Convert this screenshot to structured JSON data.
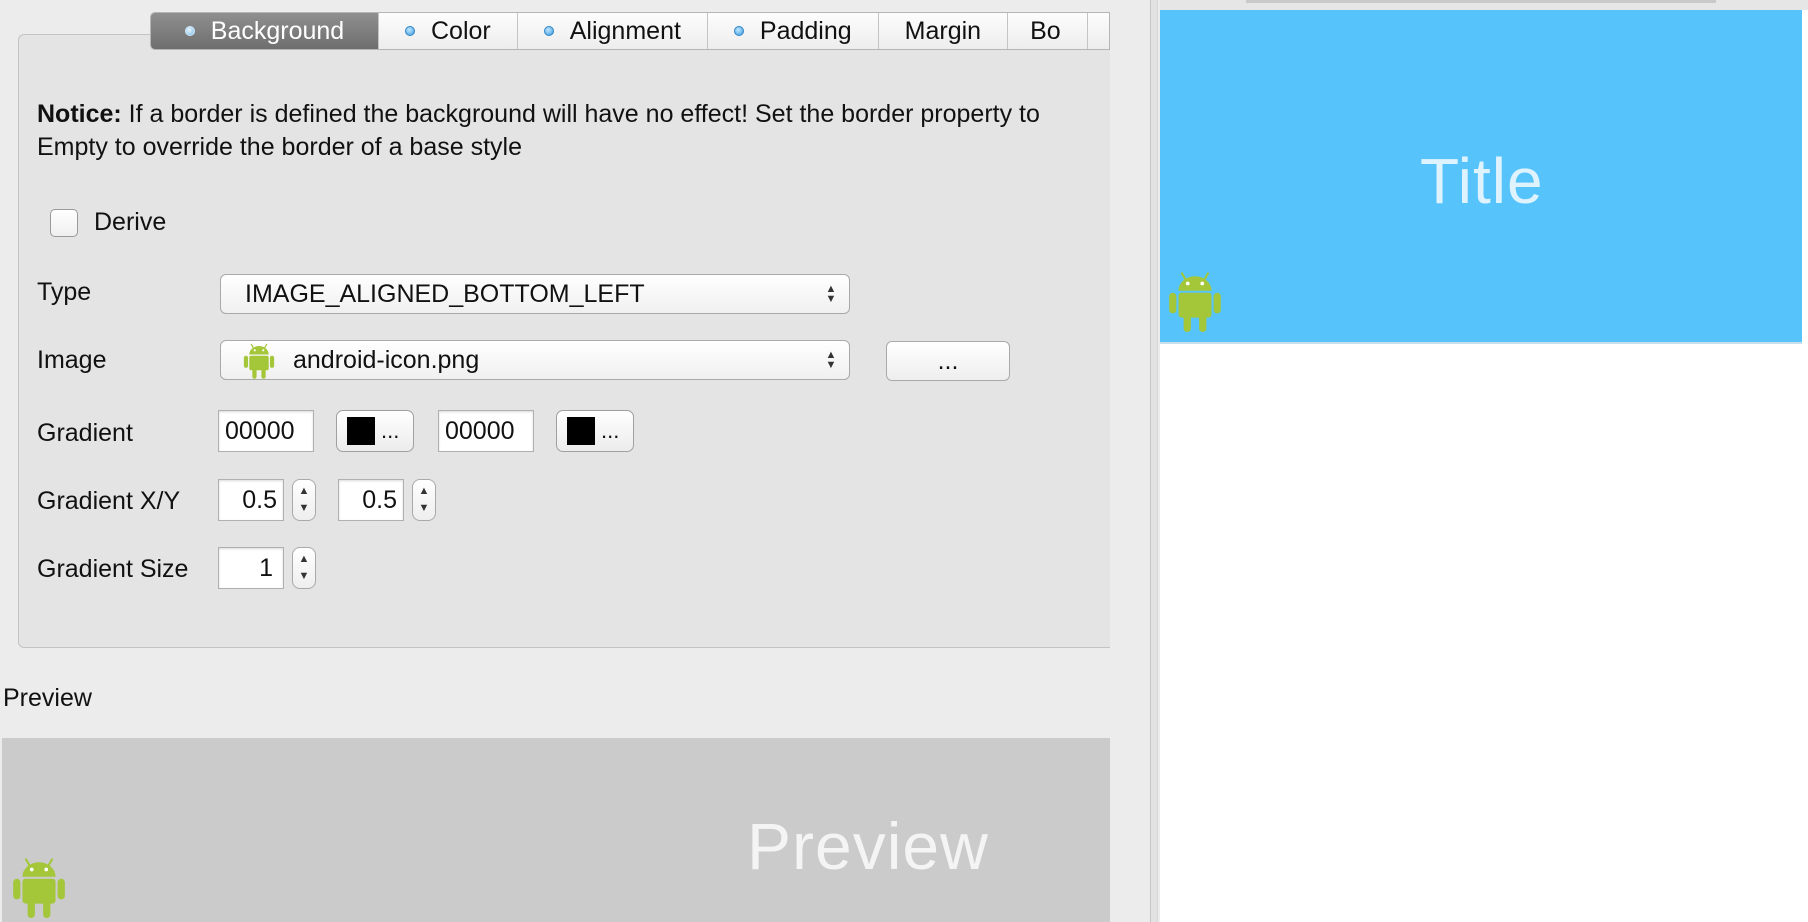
{
  "tabs": [
    {
      "label": "Background",
      "active": true,
      "dot": true
    },
    {
      "label": "Color",
      "active": false,
      "dot": true
    },
    {
      "label": "Alignment",
      "active": false,
      "dot": true
    },
    {
      "label": "Padding",
      "active": false,
      "dot": true
    },
    {
      "label": "Margin",
      "active": false,
      "dot": false
    },
    {
      "label": "Bo",
      "active": false,
      "dot": false
    }
  ],
  "notice": {
    "bold": "Notice:",
    "text": " If a border is defined the background will have no effect! Set the border property to Empty to override the border of a base style"
  },
  "derive": {
    "label": "Derive",
    "checked": false
  },
  "form": {
    "type_label": "Type",
    "type_value": "IMAGE_ALIGNED_BOTTOM_LEFT",
    "image_label": "Image",
    "image_value": "android-icon.png",
    "image_browse_label": "...",
    "gradient_label": "Gradient",
    "gradient_start": "00000",
    "gradient_end": "00000",
    "color_button_label": "...",
    "gradient_xy_label": "Gradient X/Y",
    "gradient_x": "0.5",
    "gradient_y": "0.5",
    "gradient_size_label": "Gradient Size",
    "gradient_size": "1"
  },
  "preview": {
    "heading": "Preview",
    "text": "Preview"
  },
  "canvas": {
    "title": "Title"
  },
  "colors": {
    "banner": "#56c4fb",
    "android_green": "#a4c639",
    "swatch": "#000000"
  },
  "icons": {
    "android": "android-icon",
    "spinner": "spinner-arrows-icon",
    "select_arrows": "select-arrows-icon"
  }
}
